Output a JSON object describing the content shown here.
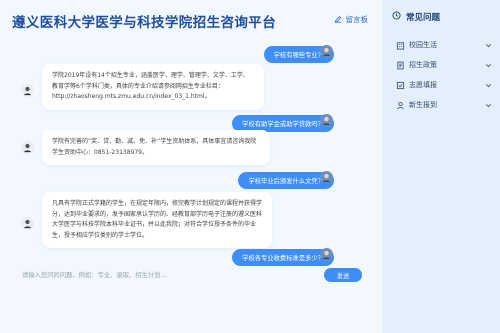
{
  "app": {
    "title": "遵义医科大学医学与科技学院招生咨询平台",
    "guestbook_label": "留言板"
  },
  "messages": [
    {
      "role": "question",
      "text": "学校有哪些专业？"
    },
    {
      "role": "answer",
      "text": "学院2019年设有14个招生专业，涵盖医学、理学、管理学、文学、工学、教育学等6个学科门类，具体的专业介绍请参阅网招生专业栏目：http://zhaosheng.mts.zmu.edu.cn/index_03_1.html。"
    },
    {
      "role": "question",
      "text": "学校有助学金或助学贷款吗？"
    },
    {
      "role": "answer",
      "text": "学院有完善的“奖、贷、勤、减、免、补”学生资助体系，具体事宜请咨询我院学生资助中心：0851-23138979。"
    },
    {
      "role": "question",
      "text": "学校毕业后颁发什么文凭？"
    },
    {
      "role": "answer",
      "text": "凡具有学院正式学籍的学生，在规定年限内，修完教学计划规定的课程并获得学分，达到毕业要求的，发予国家承认学历的、经教育部学历电子注册的遵义医科大学医学与科技学院本科毕业证书，并以此我院；对符合学位授予条件的毕业生，授予相应学位类别的学士学位。"
    },
    {
      "role": "question",
      "text": "学校各专业收费标准是多少？"
    }
  ],
  "input": {
    "placeholder": "请输入您问的问题，例如：专业、录取、招生计划...",
    "value": "",
    "send_label": "发送"
  },
  "sidebar": {
    "title": "常见问题",
    "items": [
      {
        "label": "校园生活",
        "icon": "building-icon"
      },
      {
        "label": "招生政策",
        "icon": "document-icon"
      },
      {
        "label": "志愿填报",
        "icon": "form-icon"
      },
      {
        "label": "新生报到",
        "icon": "person-icon"
      }
    ]
  },
  "colors": {
    "accent": "#3f8ef7",
    "title": "#1f4f9c",
    "background": "#f2f8fe",
    "sidebar": "#e3effc"
  }
}
